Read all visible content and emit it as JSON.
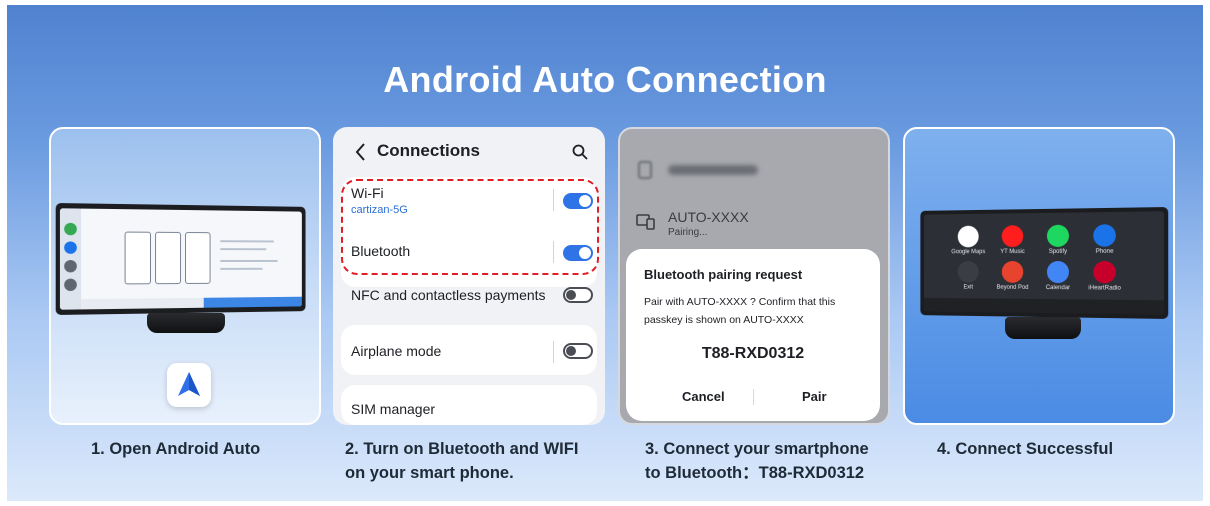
{
  "headline": "Android Auto Connection",
  "steps": [
    {
      "caption_line1": "1. Open Android Auto",
      "caption_line2": ""
    },
    {
      "caption_line1": "2. Turn on Bluetooth and WIFI",
      "caption_line2": "on your smart phone."
    },
    {
      "caption_line1": "3. Connect your smartphone",
      "caption_line2": "to Bluetooth：T88-RXD0312"
    },
    {
      "caption_line1": "4. Connect Successful",
      "caption_line2": ""
    }
  ],
  "connections": {
    "title": "Connections",
    "wifi_label": "Wi-Fi",
    "wifi_network": "cartizan-5G",
    "bluetooth_label": "Bluetooth",
    "nfc_label": "NFC and contactless payments",
    "airplane_label": "Airplane mode",
    "sim_label": "SIM manager",
    "wifi_on": true,
    "bluetooth_on": true,
    "nfc_on": false,
    "airplane_on": false
  },
  "pairing": {
    "device_name": "AUTO-XXXX",
    "device_status": "Pairing...",
    "dialog_title": "Bluetooth pairing request",
    "dialog_line1": "Pair with AUTO-XXXX ? Confirm that this",
    "dialog_line2": "passkey is shown on AUTO-XXXX",
    "passkey": "T88-RXD0312",
    "cancel_label": "Cancel",
    "pair_label": "Pair"
  },
  "car_apps": [
    {
      "name": "Google Maps",
      "color": "#ffffff"
    },
    {
      "name": "YT Music",
      "color": "#ff1d1d"
    },
    {
      "name": "Spotify",
      "color": "#1ed760"
    },
    {
      "name": "Phone",
      "color": "#1a73e8"
    },
    {
      "name": "Exit",
      "color": "#3a3d43"
    },
    {
      "name": "Beyond Pod",
      "color": "#e8432e"
    },
    {
      "name": "Calendar",
      "color": "#4285f4"
    },
    {
      "name": "iHeartRadio",
      "color": "#c6002b"
    }
  ],
  "colors": {
    "accent": "#2e74e6",
    "highlight": "#e01e26"
  }
}
